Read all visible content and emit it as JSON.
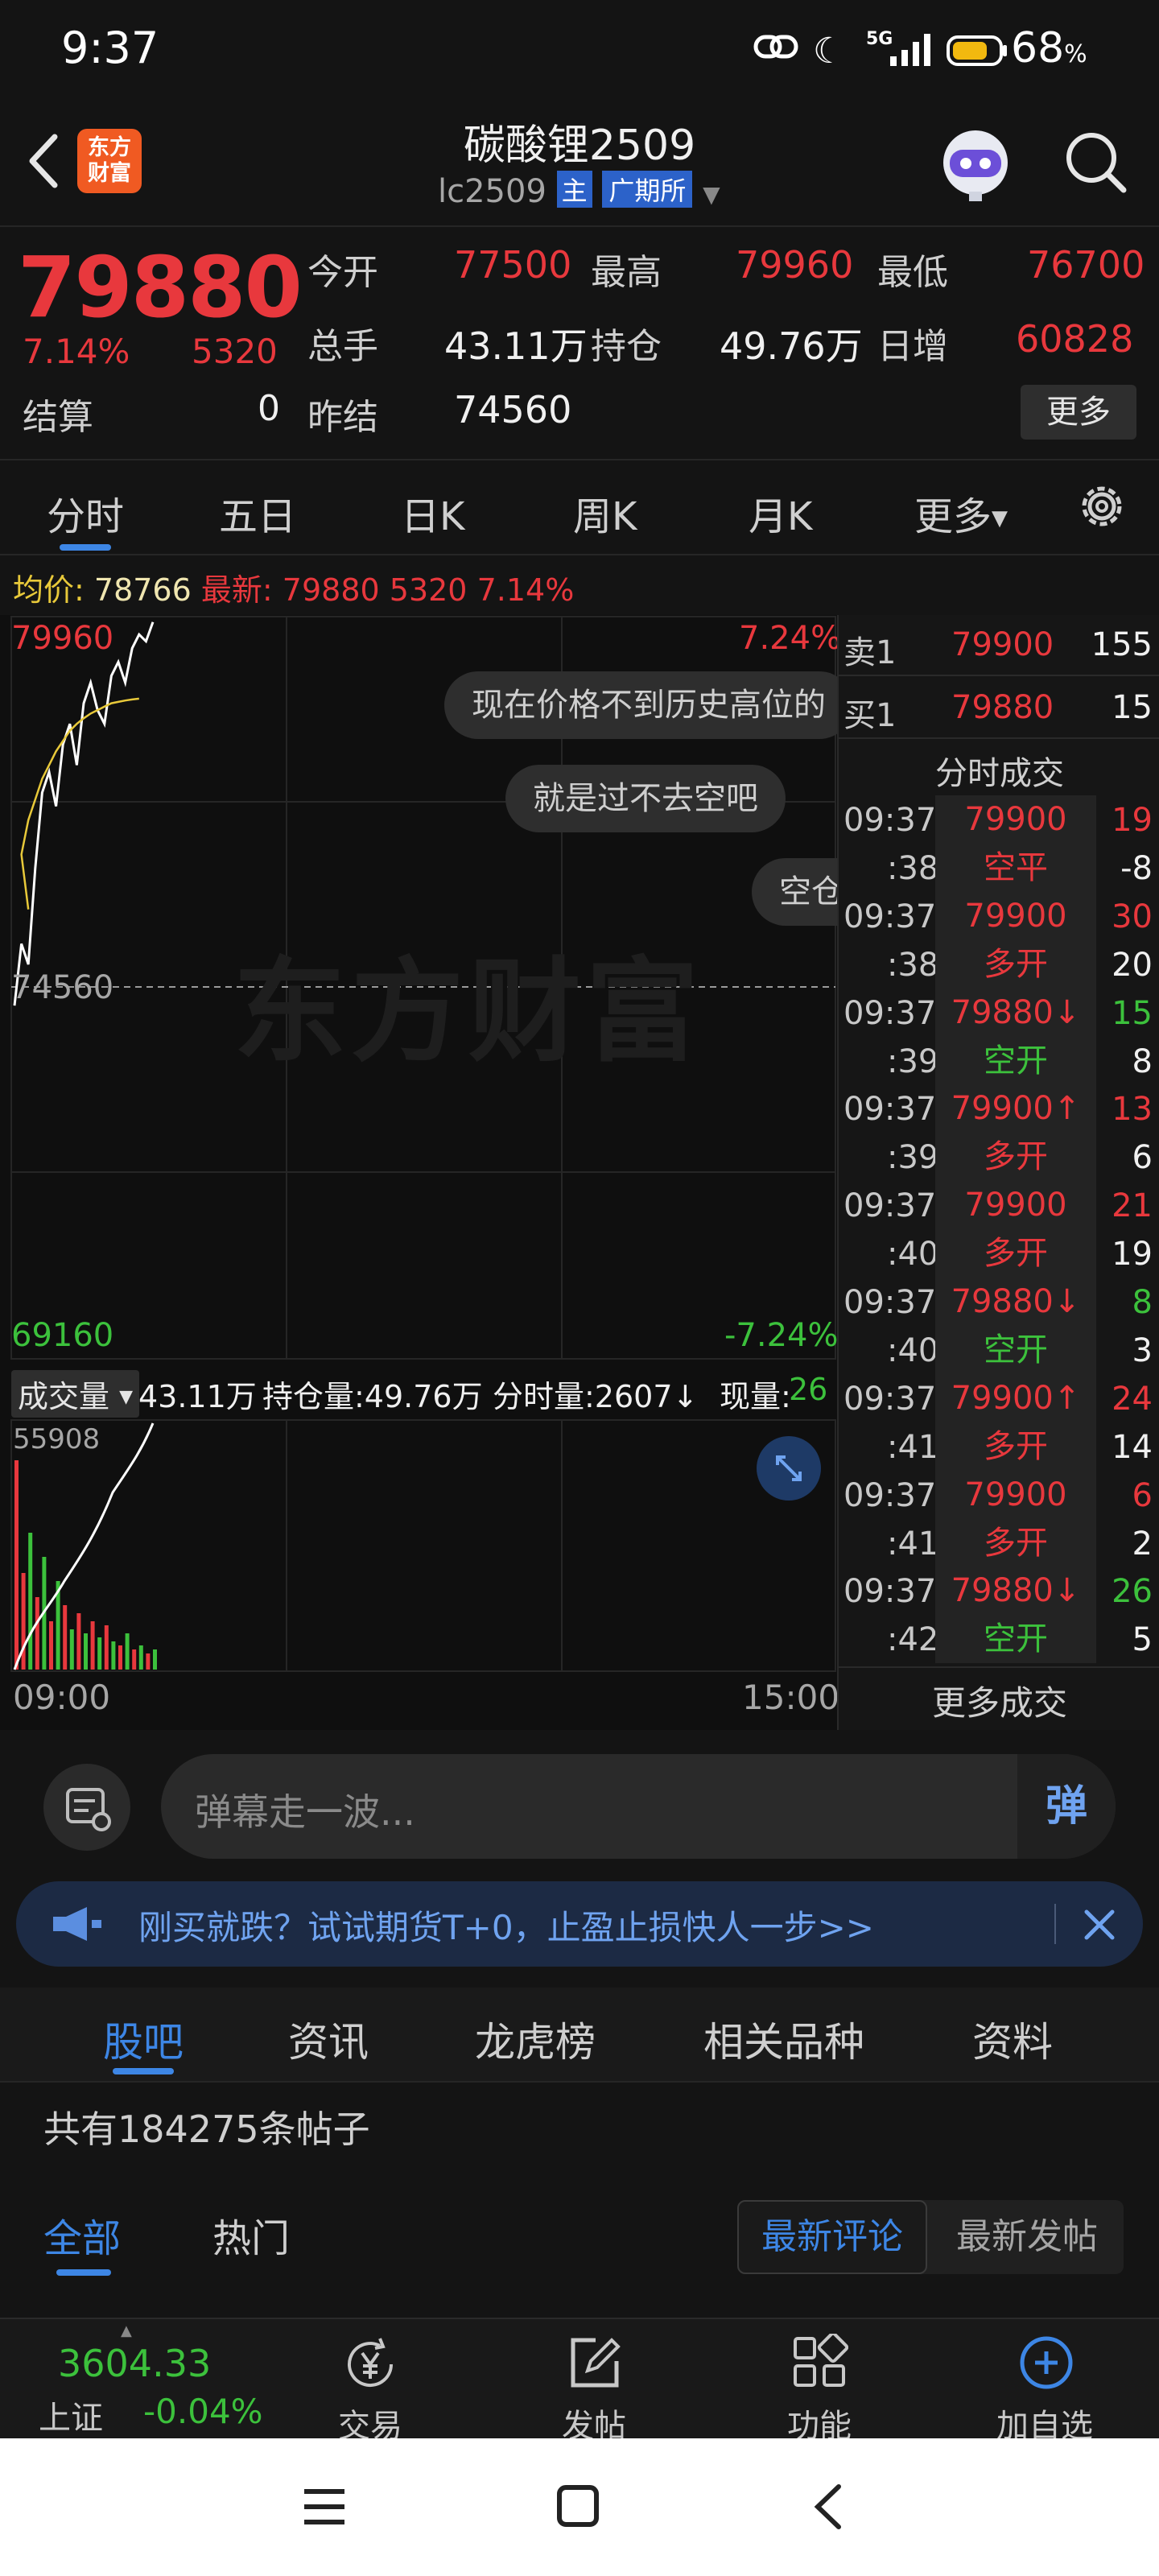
{
  "status_bar": {
    "time": "9:37",
    "battery": "68",
    "battery_unit": "%",
    "network": "5G"
  },
  "header": {
    "title": "碳酸锂2509",
    "code": "lc2509",
    "main_badge": "主",
    "exchange": "广期所",
    "logo_text_line1": "东方",
    "logo_text_line2": "财富"
  },
  "quote": {
    "last_price": "79880",
    "change_pct": "7.14%",
    "change": "5320",
    "settle_label": "结算",
    "settle_value": "0",
    "open_label": "今开",
    "open_value": "77500",
    "high_label": "最高",
    "high_value": "79960",
    "low_label": "最低",
    "low_value": "76700",
    "volume_label": "总手",
    "volume_value": "43.11万",
    "oi_label": "持仓",
    "oi_value": "49.76万",
    "daily_inc_label": "日增",
    "daily_inc_value": "60828",
    "prev_settle_label": "昨结",
    "prev_settle_value": "74560",
    "more_button": "更多"
  },
  "tabs": {
    "items": [
      "分时",
      "五日",
      "日K",
      "周K",
      "月K",
      "更多"
    ],
    "active": "分时"
  },
  "avg_bar": {
    "avg_label": "均价:",
    "avg_value": "78766",
    "latest_label": "最新:",
    "latest_value": "79880",
    "change": "5320",
    "pct": "7.14%"
  },
  "chart": {
    "upper_price": "79960",
    "upper_pct": "7.24%",
    "mid_price": "74560",
    "lower_price": "69160",
    "lower_pct": "-7.24%",
    "watermark": "东方财富",
    "start_time": "09:00",
    "end_time": "15:00",
    "vol_max": "55908",
    "volume_selector": "成交量",
    "vol_total": "43.11万",
    "oi_label": "持仓量:49.76万",
    "minute_vol_label": "分时量:2607",
    "current_vol_label": "现量:",
    "current_vol_value": "26",
    "price_series": [
      74300,
      75200,
      74900,
      76300,
      77400,
      77700,
      77200,
      78100,
      78400,
      77800,
      78700,
      79000,
      78600,
      78400,
      79100,
      79300,
      79000,
      79500,
      79700,
      79600,
      79880
    ],
    "avg_series": [
      74300,
      75000,
      75700,
      76500,
      77000,
      77300,
      77600,
      77800,
      78000,
      78150,
      78300,
      78400,
      78480,
      78550,
      78600,
      78650,
      78700,
      78720,
      78740,
      78755,
      78766
    ]
  },
  "bullet_comments": [
    "现在价格不到历史高位的",
    "就是过不去空吧",
    "空仓"
  ],
  "order_book": {
    "sell1_label": "卖1",
    "sell1_price": "79900",
    "sell1_vol": "155",
    "buy1_label": "买1",
    "buy1_price": "79880",
    "buy1_vol": "15",
    "ticks_title": "分时成交",
    "ticks": [
      {
        "time": "09:37",
        "price": "79900",
        "vol": "19",
        "pcolor": "red",
        "vcolor": "red"
      },
      {
        "time": ":38",
        "price": "空平",
        "vol": "-8",
        "pcolor": "red",
        "vcolor": "white"
      },
      {
        "time": "09:37",
        "price": "79900",
        "vol": "30",
        "pcolor": "red",
        "vcolor": "red"
      },
      {
        "time": ":38",
        "price": "多开",
        "vol": "20",
        "pcolor": "red",
        "vcolor": "white"
      },
      {
        "time": "09:37",
        "price": "79880↓",
        "vol": "15",
        "pcolor": "red",
        "vcolor": "green"
      },
      {
        "time": ":39",
        "price": "空开",
        "vol": "8",
        "pcolor": "green",
        "vcolor": "white"
      },
      {
        "time": "09:37",
        "price": "79900↑",
        "vol": "13",
        "pcolor": "red",
        "vcolor": "red"
      },
      {
        "time": ":39",
        "price": "多开",
        "vol": "6",
        "pcolor": "red",
        "vcolor": "white"
      },
      {
        "time": "09:37",
        "price": "79900",
        "vol": "21",
        "pcolor": "red",
        "vcolor": "red"
      },
      {
        "time": ":40",
        "price": "多开",
        "vol": "19",
        "pcolor": "red",
        "vcolor": "white"
      },
      {
        "time": "09:37",
        "price": "79880↓",
        "vol": "8",
        "pcolor": "red",
        "vcolor": "green"
      },
      {
        "time": ":40",
        "price": "空开",
        "vol": "3",
        "pcolor": "green",
        "vcolor": "white"
      },
      {
        "time": "09:37",
        "price": "79900↑",
        "vol": "24",
        "pcolor": "red",
        "vcolor": "red"
      },
      {
        "time": ":41",
        "price": "多开",
        "vol": "14",
        "pcolor": "red",
        "vcolor": "white"
      },
      {
        "time": "09:37",
        "price": "79900",
        "vol": "6",
        "pcolor": "red",
        "vcolor": "red"
      },
      {
        "time": ":41",
        "price": "多开",
        "vol": "2",
        "pcolor": "red",
        "vcolor": "white"
      },
      {
        "time": "09:37",
        "price": "79880↓",
        "vol": "26",
        "pcolor": "red",
        "vcolor": "green"
      },
      {
        "time": ":42",
        "price": "空开",
        "vol": "5",
        "pcolor": "green",
        "vcolor": "white"
      }
    ],
    "more_ticks": "更多成交"
  },
  "danmu": {
    "placeholder": "弹幕走一波...",
    "button": "弹"
  },
  "promo": {
    "text": "刚买就跌？试试期货T+0，止盈止损快人一步>>"
  },
  "forum": {
    "tabs": [
      "股吧",
      "资讯",
      "龙虎榜",
      "相关品种",
      "资料"
    ],
    "active_tab": "股吧",
    "post_count": "共有184275条帖子",
    "subtabs": [
      "全部",
      "热门"
    ],
    "sort_options": [
      "最新评论",
      "最新发帖"
    ]
  },
  "bottom_nav": {
    "index_value": "3604.33",
    "index_name": "上证",
    "index_change": "-0.04%",
    "items": [
      "交易",
      "发帖",
      "功能",
      "加自选"
    ]
  },
  "colors": {
    "up": "#e8383d",
    "down": "#3cc13c",
    "accent": "#3d86e5",
    "avg": "#e8c93a"
  }
}
